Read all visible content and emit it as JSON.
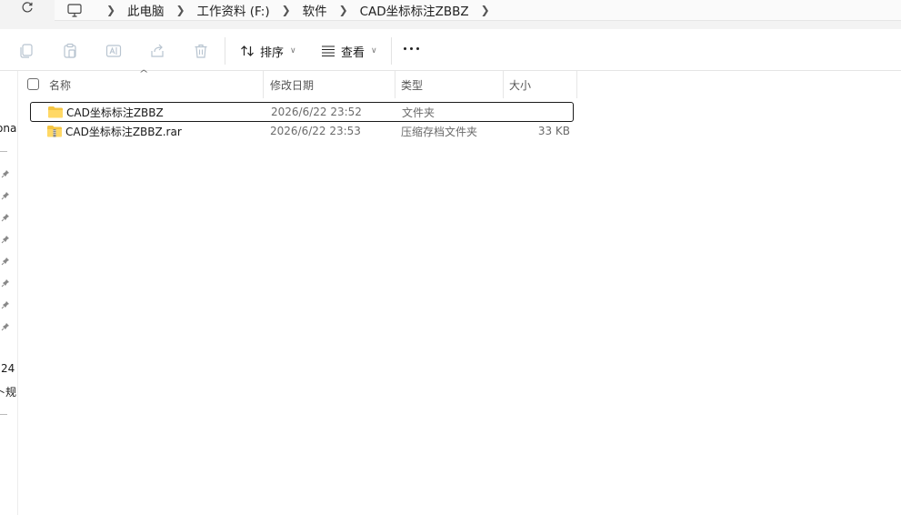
{
  "breadcrumb": [
    "此电脑",
    "工作资料 (F:)",
    "软件",
    "CAD坐标标注ZBBZ"
  ],
  "toolbar": {
    "sort_label": "排序",
    "view_label": "查看"
  },
  "nav": {
    "partial_texts": [
      "ona",
      "24",
      "卜规"
    ]
  },
  "columns": {
    "name": "名称",
    "date": "修改日期",
    "type": "类型",
    "size": "大小"
  },
  "files": [
    {
      "name": "CAD坐标标注ZBBZ",
      "date": "2026/6/22 23:52",
      "type": "文件夹",
      "size": "",
      "icon": "folder-icon",
      "selected": true
    },
    {
      "name": "CAD坐标标注ZBBZ.rar",
      "date": "2026/6/22 23:53",
      "type": "压缩存档文件夹",
      "size": "33 KB",
      "icon": "zip-folder-icon",
      "selected": false
    }
  ],
  "colors": {
    "folder": "#f5c542",
    "toolbar_icon_disabled": "#b8c4d0",
    "accent_border": "#1a1a1a"
  }
}
